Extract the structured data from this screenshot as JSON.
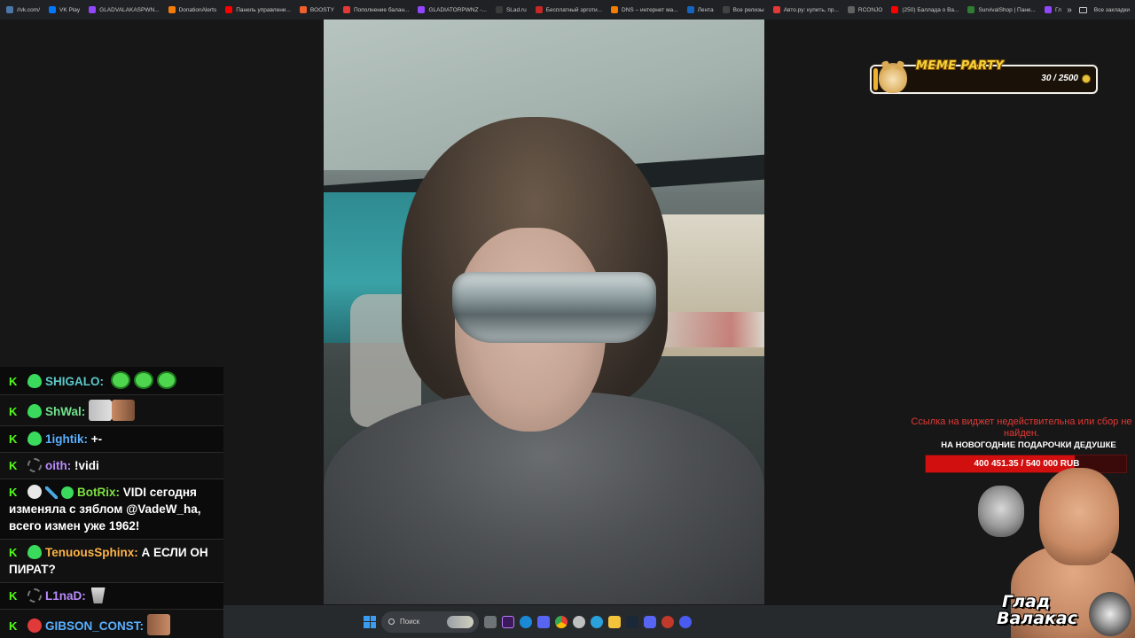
{
  "bookmarks": [
    {
      "label": "//vk.com/",
      "color": "#4a76a8"
    },
    {
      "label": "VK Play",
      "color": "#0077ff"
    },
    {
      "label": "GLADVALAKASPWN...",
      "color": "#9146ff"
    },
    {
      "label": "DonationAlerts",
      "color": "#f57d07"
    },
    {
      "label": "Панель управлени...",
      "color": "#ff0000"
    },
    {
      "label": "BOOSTY",
      "color": "#f15f2c"
    },
    {
      "label": "Пополнение балан...",
      "color": "#e53935"
    },
    {
      "label": "GLADIATORPWNZ -...",
      "color": "#9146ff"
    },
    {
      "label": "SLad.ru",
      "color": "#3a3a3a"
    },
    {
      "label": "Бесплатный эрготи...",
      "color": "#c62828"
    },
    {
      "label": "DNS – интернет ма...",
      "color": "#f57c00"
    },
    {
      "label": "Лента",
      "color": "#1565c0"
    },
    {
      "label": "Все релизы",
      "color": "#424242"
    },
    {
      "label": "Авто.ру: купить, пр...",
      "color": "#e53935"
    },
    {
      "label": "RCONJO",
      "color": "#616161"
    },
    {
      "label": "(250) Баллада о Ва...",
      "color": "#ff0000"
    },
    {
      "label": "SurvivalShop | Пане...",
      "color": "#2e7d32"
    },
    {
      "label": "Глад Валакас RUST",
      "color": "#9146ff"
    }
  ],
  "bookmarks_all": "Все закладки",
  "meme_party": {
    "title": "MEME PARTY",
    "count": "30 / 2500",
    "progress_fraction": 0.012
  },
  "chat": [
    {
      "user": "SHIGALO:",
      "text": "",
      "user_color": "teal"
    },
    {
      "user": "ShWal:",
      "text": "",
      "user_color": "green"
    },
    {
      "user": "1ightik:",
      "text": " +-",
      "user_color": "blue"
    },
    {
      "user": "oith:",
      "text": " !vidi",
      "user_color": "purple"
    },
    {
      "user": "BotRix:",
      "text": " VIDI сегодня изменяла с зяблом @VadeW_ha, всего измен уже 1962!",
      "user_color": "lime"
    },
    {
      "user": "TenuousSphinx:",
      "text": " А ЕСЛИ ОН ПИРАТ?",
      "user_color": "orange"
    },
    {
      "user": "L1naD:",
      "text": "",
      "user_color": "purple"
    },
    {
      "user": "GIBSON_CONST:",
      "text": "",
      "user_color": "blue"
    }
  ],
  "kick_badge": "K",
  "taskbar": {
    "search_placeholder": "Поиск"
  },
  "donation": {
    "error": "Ссылка на виджет недействительна или сбор не найден.",
    "goal_title": "НА НОВОГОДНИЕ ПОДАРОЧКИ ДЕДУШКЕ",
    "goal_amount": "400 451.35 / 540 000 RUB",
    "goal_fraction": 0.7416
  },
  "logo": {
    "line1": "Глад",
    "line2": "Валакас"
  }
}
